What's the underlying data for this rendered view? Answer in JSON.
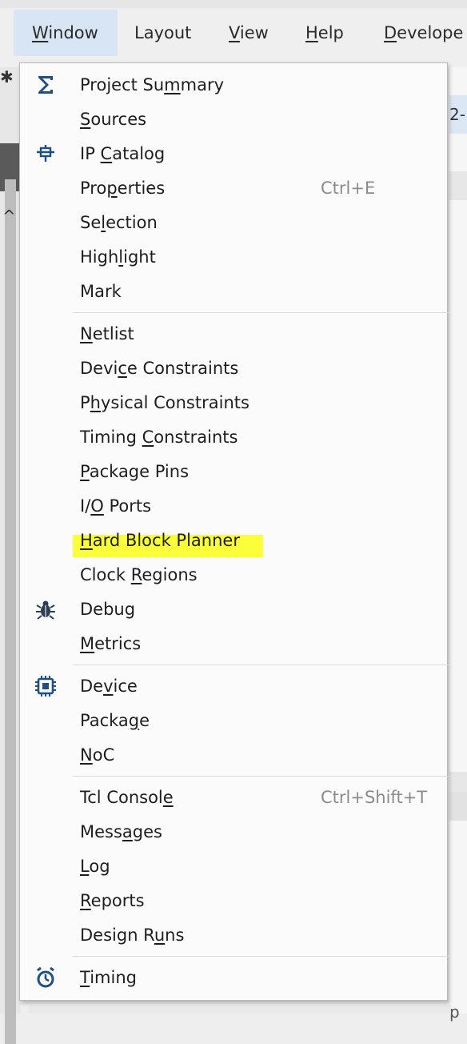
{
  "menubar": {
    "items": [
      {
        "label": "Window",
        "mnemonic_index": 0,
        "active": true
      },
      {
        "label": "Layout",
        "mnemonic_index": -1,
        "active": false
      },
      {
        "label": "View",
        "mnemonic_index": 0,
        "active": false
      },
      {
        "label": "Help",
        "mnemonic_index": 0,
        "active": false
      },
      {
        "label": "Develope",
        "mnemonic_index": 0,
        "active": false
      }
    ]
  },
  "background": {
    "right_tab_text": "2-",
    "right_partial_text": "p"
  },
  "window_menu": {
    "highlight_color": "#fbff3a",
    "groups": [
      {
        "items": [
          {
            "label": "Project Summary",
            "mnemonic_index": 10,
            "icon": "sigma-icon",
            "shortcut": ""
          },
          {
            "label": "Sources",
            "mnemonic_index": 0,
            "icon": "",
            "shortcut": ""
          },
          {
            "label": "IP Catalog",
            "mnemonic_index": 3,
            "icon": "ip-catalog-icon",
            "shortcut": ""
          },
          {
            "label": "Properties",
            "mnemonic_index": 3,
            "icon": "",
            "shortcut": "Ctrl+E"
          },
          {
            "label": "Selection",
            "mnemonic_index": 2,
            "icon": "",
            "shortcut": ""
          },
          {
            "label": "Highlight",
            "mnemonic_index": 4,
            "icon": "",
            "shortcut": ""
          },
          {
            "label": "Mark",
            "mnemonic_index": -1,
            "icon": "",
            "shortcut": ""
          }
        ]
      },
      {
        "items": [
          {
            "label": "Netlist",
            "mnemonic_index": 0,
            "icon": "",
            "shortcut": ""
          },
          {
            "label": "Device Constraints",
            "mnemonic_index": 4,
            "icon": "",
            "shortcut": ""
          },
          {
            "label": "Physical Constraints",
            "mnemonic_index": 1,
            "icon": "",
            "shortcut": ""
          },
          {
            "label": "Timing Constraints",
            "mnemonic_index": 7,
            "icon": "",
            "shortcut": ""
          },
          {
            "label": "Package Pins",
            "mnemonic_index": 0,
            "icon": "",
            "shortcut": ""
          },
          {
            "label": "I/O Ports",
            "mnemonic_index": 2,
            "icon": "",
            "shortcut": ""
          },
          {
            "label": "Hard Block Planner",
            "mnemonic_index": 0,
            "icon": "",
            "shortcut": "",
            "highlighted": true
          },
          {
            "label": "Clock Regions",
            "mnemonic_index": 6,
            "icon": "",
            "shortcut": ""
          },
          {
            "label": "Debug",
            "mnemonic_index": -1,
            "icon": "bug-icon",
            "shortcut": ""
          },
          {
            "label": "Metrics",
            "mnemonic_index": 0,
            "icon": "",
            "shortcut": ""
          }
        ]
      },
      {
        "items": [
          {
            "label": "Device",
            "mnemonic_index": 2,
            "icon": "chip-icon",
            "shortcut": ""
          },
          {
            "label": "Package",
            "mnemonic_index": 5,
            "icon": "",
            "shortcut": ""
          },
          {
            "label": "NoC",
            "mnemonic_index": 0,
            "icon": "",
            "shortcut": ""
          }
        ]
      },
      {
        "items": [
          {
            "label": "Tcl Console",
            "mnemonic_index": 10,
            "icon": "",
            "shortcut": "Ctrl+Shift+T"
          },
          {
            "label": "Messages",
            "mnemonic_index": 4,
            "icon": "",
            "shortcut": ""
          },
          {
            "label": "Log",
            "mnemonic_index": 0,
            "icon": "",
            "shortcut": ""
          },
          {
            "label": "Reports",
            "mnemonic_index": 0,
            "icon": "",
            "shortcut": ""
          },
          {
            "label": "Design Runs",
            "mnemonic_index": 8,
            "icon": "",
            "shortcut": ""
          }
        ]
      },
      {
        "items": [
          {
            "label": "Timing",
            "mnemonic_index": 0,
            "icon": "stopwatch-icon",
            "shortcut": ""
          }
        ]
      }
    ]
  }
}
